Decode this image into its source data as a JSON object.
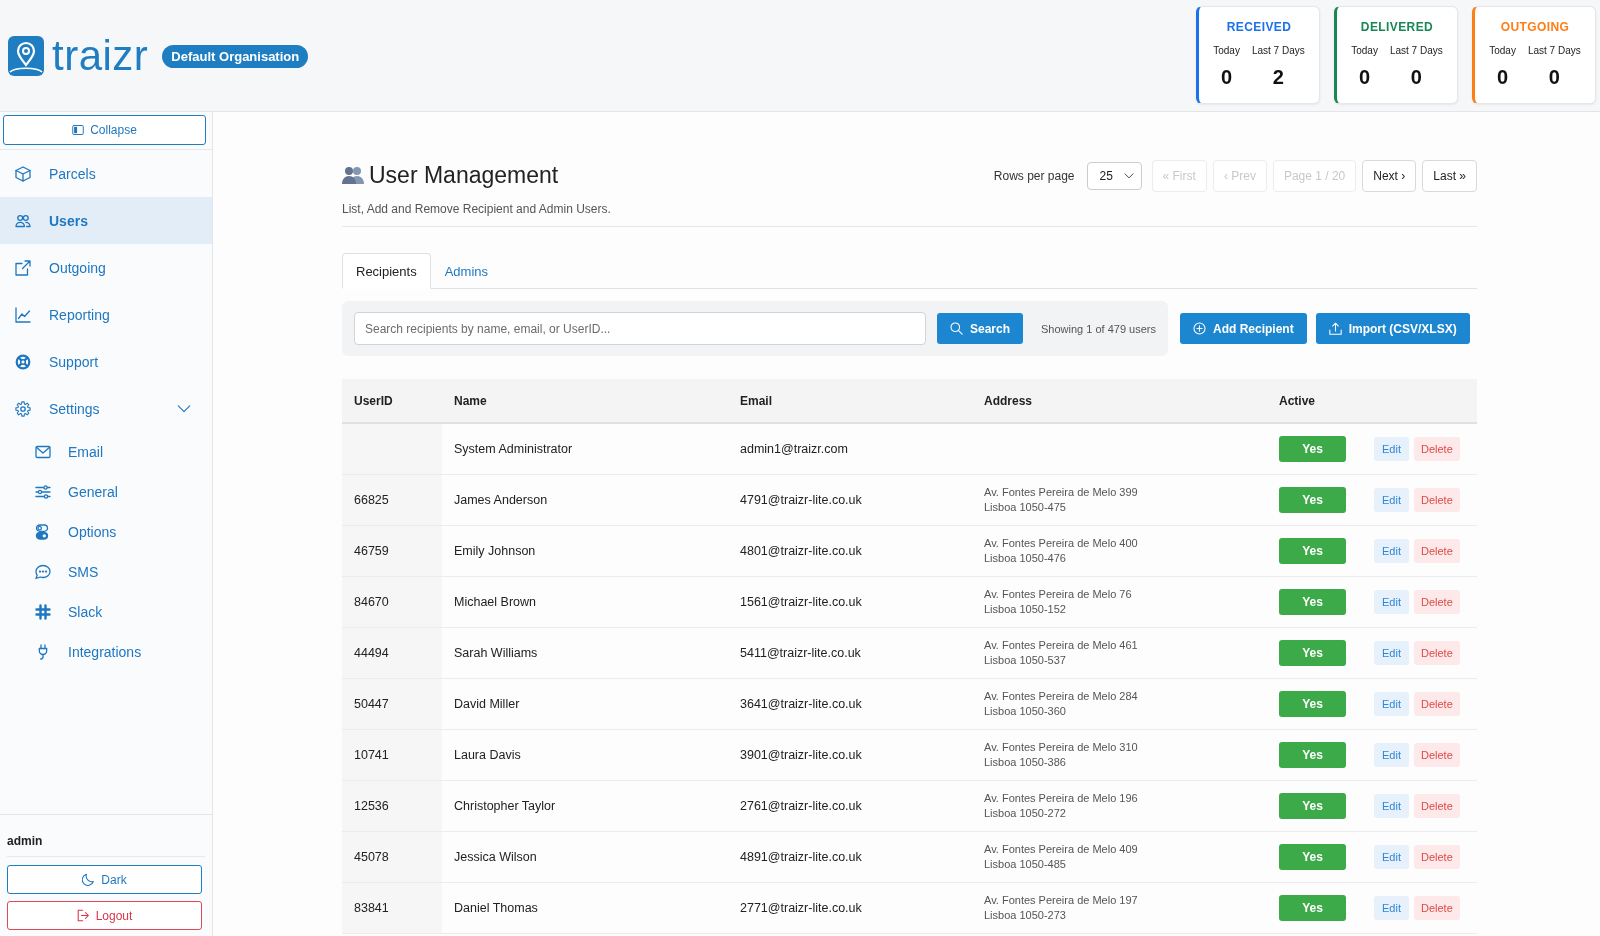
{
  "header": {
    "logo_text": "traizr",
    "organisation": "Default Organisation",
    "stats": [
      {
        "title": "RECEIVED",
        "color": "#1a73e8",
        "today_label": "Today",
        "week_label": "Last 7 Days",
        "today": "0",
        "week": "2"
      },
      {
        "title": "DELIVERED",
        "color": "#198754",
        "today_label": "Today",
        "week_label": "Last 7 Days",
        "today": "0",
        "week": "0"
      },
      {
        "title": "OUTGOING",
        "color": "#fd7e14",
        "today_label": "Today",
        "week_label": "Last 7 Days",
        "today": "0",
        "week": "0"
      }
    ]
  },
  "sidebar": {
    "collapse_button": "Collapse",
    "items": [
      {
        "label": "Parcels",
        "selected": false
      },
      {
        "label": "Users",
        "selected": true
      },
      {
        "label": "Outgoing",
        "selected": false
      },
      {
        "label": "Reporting",
        "selected": false
      },
      {
        "label": "Support",
        "selected": false
      },
      {
        "label": "Settings",
        "selected": false,
        "expanded": true,
        "children": [
          {
            "label": "Email",
            "selected": false
          },
          {
            "label": "General",
            "selected": false
          },
          {
            "label": "Options",
            "selected": false
          },
          {
            "label": "SMS",
            "selected": false
          },
          {
            "label": "Slack",
            "selected": false
          },
          {
            "label": "Integrations",
            "selected": false
          }
        ]
      }
    ],
    "user": "admin",
    "dark_button": "Dark",
    "logout_button": "Logout"
  },
  "page": {
    "title": "User Management",
    "subtitle": "List, Add and Remove Recipient and Admin Users.",
    "pagination": {
      "rows_per_page_label": "Rows per page",
      "rows_per_page": "25",
      "buttons": [
        {
          "label": "« First",
          "disabled": true
        },
        {
          "label": "‹ Prev",
          "disabled": true
        },
        {
          "label": "Page 1 / 20",
          "disabled": true
        },
        {
          "label": "Next ›",
          "disabled": false
        },
        {
          "label": "Last »",
          "disabled": false
        }
      ]
    }
  },
  "tabs": [
    {
      "label": "Recipients",
      "selected": true
    },
    {
      "label": "Admins",
      "selected": false
    }
  ],
  "search": {
    "placeholder": "Search recipients by name, email, or UserID...",
    "button": "Search",
    "summary": "Showing 1 of 479 users"
  },
  "actions": [
    {
      "label": "Add Recipient",
      "kind": "add"
    },
    {
      "label": "Import (CSV/XLSX)",
      "kind": "import"
    }
  ],
  "table": {
    "columns": [
      "UserID",
      "Name",
      "Email",
      "Address",
      "Active"
    ],
    "rows": [
      {
        "name": "System Administrator",
        "email": "admin1@traizr.com",
        "active": "Yes",
        "edit": "Edit",
        "delete": "Delete"
      },
      {
        "user_id": "66825",
        "name": "James Anderson",
        "email": "4791@traizr-lite.co.uk",
        "address": [
          "Av. Fontes Pereira de Melo 399",
          "Lisboa 1050-475"
        ],
        "active": "Yes",
        "edit": "Edit",
        "delete": "Delete"
      },
      {
        "user_id": "46759",
        "name": "Emily Johnson",
        "email": "4801@traizr-lite.co.uk",
        "address": [
          "Av. Fontes Pereira de Melo 400",
          "Lisboa 1050-476"
        ],
        "active": "Yes",
        "edit": "Edit",
        "delete": "Delete"
      },
      {
        "user_id": "84670",
        "name": "Michael Brown",
        "email": "1561@traizr-lite.co.uk",
        "address": [
          "Av. Fontes Pereira de Melo 76",
          "Lisboa 1050-152"
        ],
        "active": "Yes",
        "edit": "Edit",
        "delete": "Delete"
      },
      {
        "user_id": "44494",
        "name": "Sarah Williams",
        "email": "5411@traizr-lite.co.uk",
        "address": [
          "Av. Fontes Pereira de Melo 461",
          "Lisboa 1050-537"
        ],
        "active": "Yes",
        "edit": "Edit",
        "delete": "Delete"
      },
      {
        "user_id": "50447",
        "name": "David Miller",
        "email": "3641@traizr-lite.co.uk",
        "address": [
          "Av. Fontes Pereira de Melo 284",
          "Lisboa 1050-360"
        ],
        "active": "Yes",
        "edit": "Edit",
        "delete": "Delete"
      },
      {
        "user_id": "10741",
        "name": "Laura Davis",
        "email": "3901@traizr-lite.co.uk",
        "address": [
          "Av. Fontes Pereira de Melo 310",
          "Lisboa 1050-386"
        ],
        "active": "Yes",
        "edit": "Edit",
        "delete": "Delete"
      },
      {
        "user_id": "12536",
        "name": "Christopher Taylor",
        "email": "2761@traizr-lite.co.uk",
        "address": [
          "Av. Fontes Pereira de Melo 196",
          "Lisboa 1050-272"
        ],
        "active": "Yes",
        "edit": "Edit",
        "delete": "Delete"
      },
      {
        "user_id": "45078",
        "name": "Jessica Wilson",
        "email": "4891@traizr-lite.co.uk",
        "address": [
          "Av. Fontes Pereira de Melo 409",
          "Lisboa 1050-485"
        ],
        "active": "Yes",
        "edit": "Edit",
        "delete": "Delete"
      },
      {
        "user_id": "83841",
        "name": "Daniel Thomas",
        "email": "2771@traizr-lite.co.uk",
        "address": [
          "Av. Fontes Pereira de Melo 197",
          "Lisboa 1050-273"
        ],
        "active": "Yes",
        "edit": "Edit",
        "delete": "Delete"
      }
    ]
  }
}
